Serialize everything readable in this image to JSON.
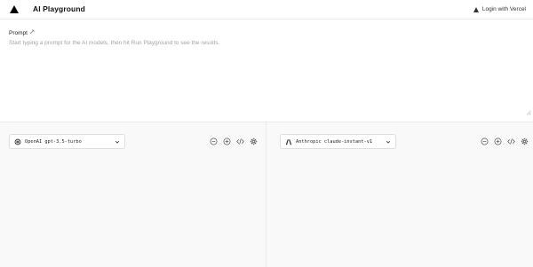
{
  "header": {
    "title": "AI Playground",
    "login_label": "Login with Vercel"
  },
  "prompt": {
    "label": "Prompt",
    "label_icon": "wand-icon",
    "placeholder": "Start typing a prompt for the AI models, then hit Run Playground to see the results."
  },
  "panels": [
    {
      "provider_icon": "openai-icon",
      "model_label": "OpenAI gpt-3.5-turbo",
      "tools": [
        "remove-icon",
        "add-icon",
        "code-icon",
        "settings-icon"
      ]
    },
    {
      "provider_icon": "anthropic-icon",
      "model_label": "Anthropic claude-instant-v1",
      "tools": [
        "remove-icon",
        "add-icon",
        "code-icon",
        "settings-icon"
      ]
    }
  ],
  "colors": {
    "background": "#ffffff",
    "panel_background": "#f9f9f9",
    "border": "#ebebeb",
    "placeholder": "#a3a3a3"
  }
}
